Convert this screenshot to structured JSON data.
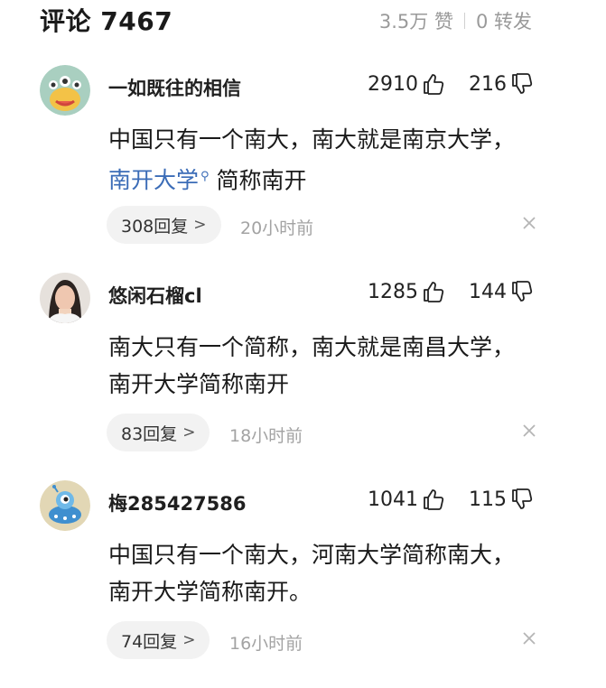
{
  "header": {
    "title": "评论 7467",
    "likes": "3.5万 赞",
    "shares": "0 转发"
  },
  "comments": [
    {
      "username": "一如既往的相信",
      "likes": "2910",
      "dislikes": "216",
      "text_before": "中国只有一个南大，南大就是南京大学，",
      "link": "南开大学",
      "link_icon": "search-icon",
      "text_after": " 简称南开",
      "replies": "308回复",
      "time": "20小时前",
      "avatar": "monster-cartoon-avatar"
    },
    {
      "username": "悠闲石榴cl",
      "likes": "1285",
      "dislikes": "144",
      "text": "南大只有一个简称，南大就是南昌大学，南开大学简称南开",
      "replies": "83回复",
      "time": "18小时前",
      "avatar": "woman-photo-avatar"
    },
    {
      "username": "梅285427586",
      "likes": "1041",
      "dislikes": "115",
      "text": "中国只有一个南大，河南大学简称南大，南开大学简称南开。",
      "replies": "74回复",
      "time": "16小时前",
      "avatar": "alien-cartoon-avatar"
    }
  ],
  "colors": {
    "link": "#3b6cb7",
    "muted": "#a3a3a3",
    "pill_bg": "#f2f2f2"
  }
}
